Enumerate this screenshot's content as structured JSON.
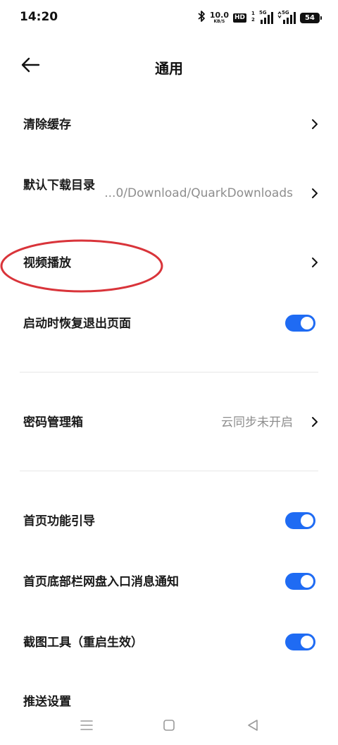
{
  "status_bar": {
    "time": "14:20",
    "net_speed_value": "10.0",
    "net_speed_unit": "KB/S",
    "hd_label": "HD",
    "sim1_label": "5G",
    "sim2_label": "5G",
    "battery": "54"
  },
  "header": {
    "title": "通用"
  },
  "rows": {
    "clear_cache": {
      "label": "清除缓存"
    },
    "download_dir": {
      "label": "默认下载目录",
      "value": "...0/Download/QuarkDownloads"
    },
    "video_play": {
      "label": "视频播放"
    },
    "restore_pages": {
      "label": "启动时恢复退出页面",
      "on": true
    },
    "password_box": {
      "label": "密码管理箱",
      "value": "云同步未开启"
    },
    "home_guide": {
      "label": "首页功能引导",
      "on": true
    },
    "home_bottom_notify": {
      "label": "首页底部栏网盘入口消息通知",
      "on": true
    },
    "screenshot_tool": {
      "label": "截图工具（重启生效）",
      "on": true
    },
    "push_settings": {
      "label": "推送设置"
    }
  },
  "colors": {
    "toggle_on": "#1f6bf3",
    "annotation": "#d9343a"
  },
  "icons": {
    "back": "arrow-left-icon",
    "chevron": "chevron-right-icon",
    "nav_menu": "menu-icon",
    "nav_home": "square-icon",
    "nav_back": "triangle-back-icon"
  }
}
